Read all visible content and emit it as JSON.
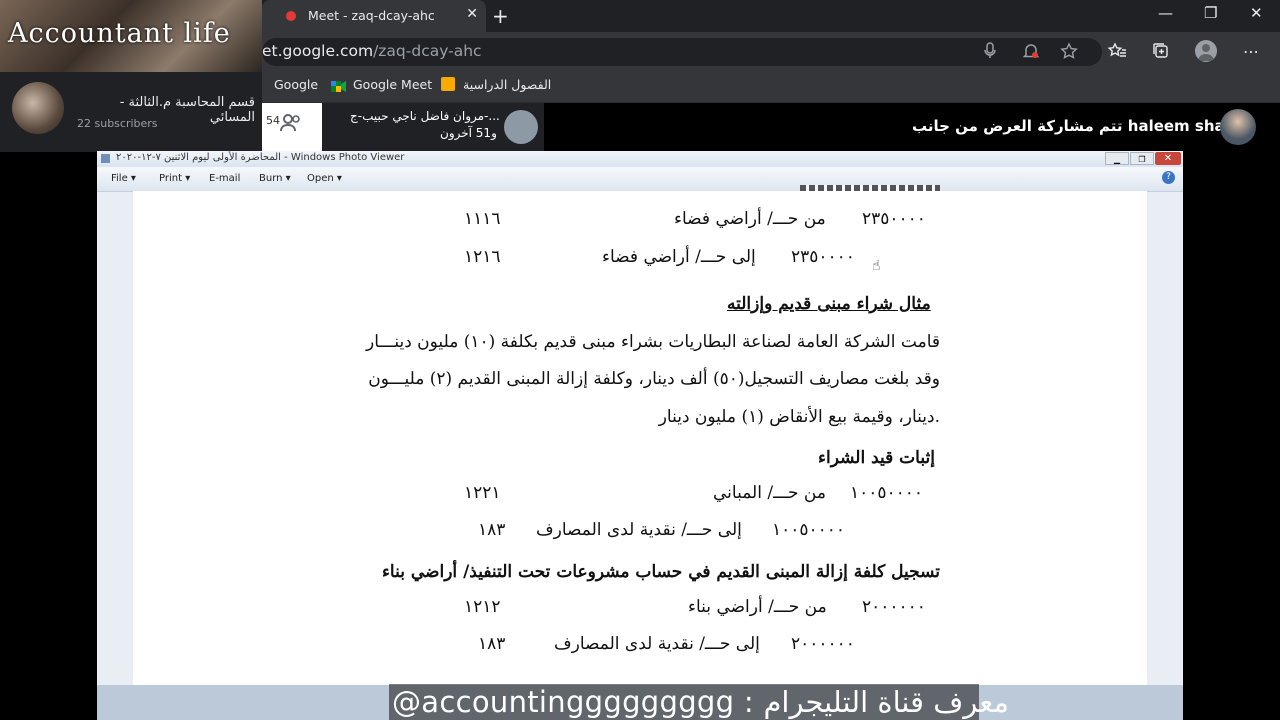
{
  "browser": {
    "tab_title": "Meet - zaq-dcay-ahc",
    "new_tab_icon": "+",
    "url_visible": "et.google.com",
    "url_path": "/zaq-dcay-ahc",
    "window_controls": {
      "minimize": "—",
      "maximize": "❐",
      "close": "✕"
    },
    "toolbar_icons": [
      "mic-icon",
      "bell-icon",
      "star-icon",
      "favorites-icon",
      "collections-icon",
      "profile-icon",
      "more-icon"
    ]
  },
  "bookmarks": [
    {
      "label": "Google"
    },
    {
      "label": "Google Meet"
    },
    {
      "label": "الفصول الدراسية"
    }
  ],
  "channel": {
    "banner_text": "Accountant life",
    "name": "قسم المحاسبة م.الثالثة - المسائي",
    "subscribers": "22 subscribers"
  },
  "meet": {
    "participant_count": "54",
    "pinned_name": "مروان فاضل ناجي حبيب-ج-...",
    "pinned_sub": "و51 آخرون",
    "presenter_text": "تتم مشاركة العرض من جانب haleem shanta"
  },
  "photo_viewer": {
    "title": "المحاضرة الأولى ليوم الاثنين ٧-١٢-٢٠٢٠ - Windows Photo Viewer",
    "menu": [
      "File",
      "Print",
      "E-mail",
      "Burn",
      "Open"
    ],
    "help": "?"
  },
  "document": {
    "lines": [
      {
        "amount": "٢٣٥٠٠٠٠",
        "text": "من حـــ/ أراضي فضاء",
        "code": "١١١٦"
      },
      {
        "amount": "٢٣٥٠٠٠٠",
        "text": "إلى حـــ/ أراضي فضاء",
        "code": "١٢١٦"
      }
    ],
    "example_heading": "مثال شراء مبنى قديم وإزالته",
    "paragraph_1": "قامت الشركة العامة لصناعة البطاريات بشراء مبنى قديم بكلفة (١٠) مليون دينـــار",
    "paragraph_2": "وقد بلغت مصاريف التسجيل(٥٠) ألف دينار، وكلفة إزالة المبنى القديم (٢) مليـــون",
    "paragraph_3": "دينار، وقيمة بيع الأنقاض (١) مليون دينار.",
    "purchase_heading": "إثبات قيد الشراء",
    "purchase_lines": [
      {
        "amount": "١٠٠٥٠٠٠٠",
        "text": "من حـــ/ المباني",
        "code": "١٢٢١"
      },
      {
        "amount": "١٠٠٥٠٠٠٠",
        "text": "إلى حـــ/ نقدية لدى المصارف",
        "code": "١٨٣"
      }
    ],
    "removal_heading": "تسجيل كلفة إزالة المبنى القديم في حساب مشروعات تحت التنفيذ/ أراضي بناء",
    "removal_lines": [
      {
        "amount": "٢٠٠٠٠٠٠",
        "text": "من حـــ/ أراضي بناء",
        "code": "١٢١٢"
      },
      {
        "amount": "٢٠٠٠٠٠٠",
        "text": "إلى حـــ/ نقدية لدى المصارف",
        "code": "١٨٣"
      }
    ]
  },
  "overlay_banner": "@accountinggggggggg : معرف قناة التليجرام"
}
